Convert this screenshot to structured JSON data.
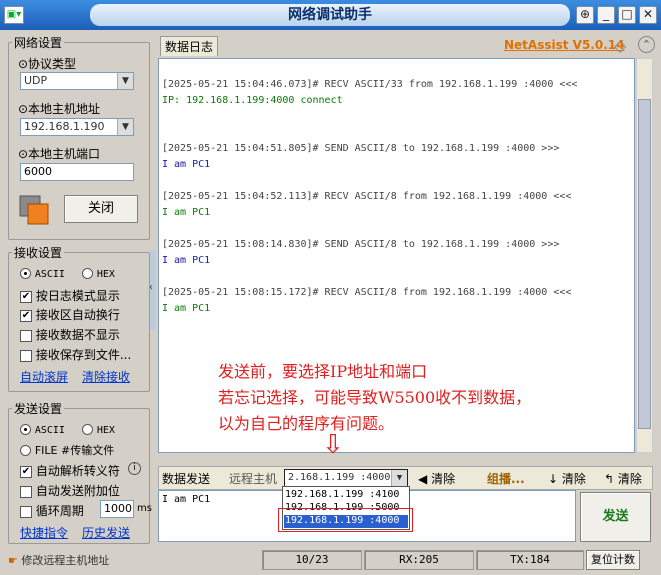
{
  "window": {
    "title": "网络调试助手",
    "sys_icon": "▣▾"
  },
  "brand": {
    "name": "NetAssist V5.0.14",
    "color": "#e07000"
  },
  "net_settings": {
    "group_title": "网络设置",
    "protocol_label": "⊙协议类型",
    "protocol_value": "UDP",
    "host_label": "⊙本地主机地址",
    "host_value": "192.168.1.190",
    "port_label": "⊙本地主机端口",
    "port_value": "6000",
    "close_button": "关闭"
  },
  "recv_settings": {
    "group_title": "接收设置",
    "ascii": "ASCII",
    "hex": "HEX",
    "opt1": "按日志模式显示",
    "opt2": "接收区自动换行",
    "opt3": "接收数据不显示",
    "opt4": "接收保存到文件...",
    "link_autoscroll": "自动滚屏",
    "link_clear": "清除接收"
  },
  "send_settings": {
    "group_title": "发送设置",
    "ascii": "ASCII",
    "hex": "HEX",
    "file": "FILE #传输文件",
    "opt1": "自动解析转义符",
    "opt2": "自动发送附加位",
    "opt3": "循环周期",
    "period": "1000",
    "period_unit": "ms",
    "link_shortcut": "快捷指令",
    "link_history": "历史发送"
  },
  "log_tab": "数据日志",
  "log": [
    {
      "header": "[2025-05-21 15:04:46.073]# RECV ASCII/33 from 192.168.1.199 :4000 <<<",
      "body": "IP: 192.168.1.199:4000 connect",
      "color": "#0a7a0a"
    },
    {
      "header": "[2025-05-21 15:04:51.805]# SEND ASCII/8 to 192.168.1.199 :4000 >>>",
      "body": "I am PC1",
      "color": "#1a1aaa"
    },
    {
      "header": "[2025-05-21 15:04:52.113]# RECV ASCII/8 from 192.168.1.199 :4000 <<<",
      "body": "I am PC1",
      "color": "#0a7a0a"
    },
    {
      "header": "[2025-05-21 15:08:14.830]# SEND ASCII/8 to 192.168.1.199 :4000 >>>",
      "body": "I am PC1",
      "color": "#1a1aaa"
    },
    {
      "header": "[2025-05-21 15:08:15.172]# RECV ASCII/8 from 192.168.1.199 :4000 <<<",
      "body": "I am PC1",
      "color": "#0a7a0a"
    }
  ],
  "annotation": {
    "line1": "发送前，要选择IP地址和端口",
    "line2": "若忘记选择，可能导致W5500收不到数据，",
    "line3": "以为自己的程序有问题。",
    "arrow": "⇩",
    "color": "#e02020"
  },
  "send_bar": {
    "tab": "数据发送",
    "remote_label": "远程主机",
    "remote_value": "2.168.1.199 :4000",
    "clear1": "清除",
    "group_label": "组播...",
    "clear2": "清除",
    "clear3": "清除",
    "options": [
      "192.168.1.199 :4100",
      "192.168.1.199 :5000",
      "192.168.1.199 :4000"
    ],
    "send_text": "I am PC1",
    "send_button": "发送"
  },
  "status": {
    "hint": "修改远程主机地址",
    "count": "10/23",
    "rx": "RX:205",
    "tx": "TX:184",
    "reset": "复位计数"
  }
}
